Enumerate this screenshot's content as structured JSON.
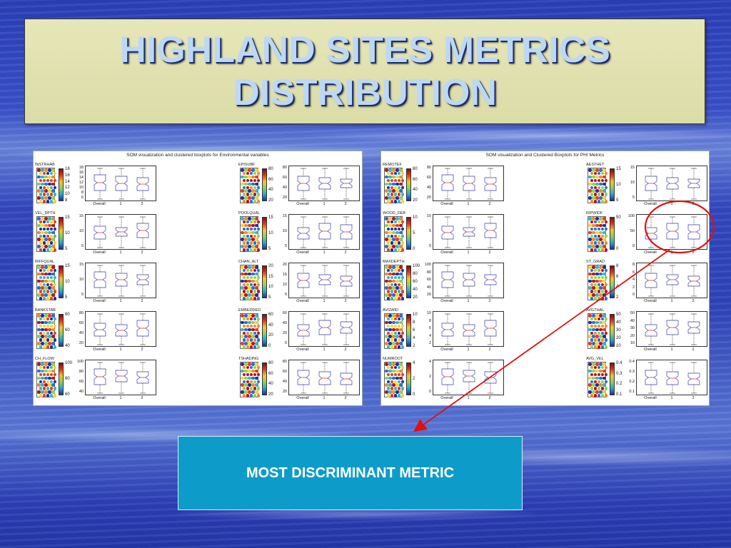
{
  "title": {
    "line1": "HIGHLAND SITES METRICS",
    "line2": "DISTRIBUTION"
  },
  "left_figure": {
    "title": "SOM visualization and clustered boxplots for Environmental variables",
    "x_labels": [
      "Overall",
      "1",
      "2"
    ],
    "panels": [
      {
        "label": "INSTRHAB",
        "cb_ticks": [
          "18",
          "16",
          "14",
          "12",
          "10",
          "8"
        ],
        "y_ticks": [
          "18",
          "16",
          "14",
          "12",
          "10",
          "8",
          "6"
        ]
      },
      {
        "label": "EPISUBF",
        "cb_ticks": [
          "80",
          "60",
          "40",
          "20"
        ],
        "y_ticks": [
          "80",
          "60",
          "40",
          "20"
        ]
      },
      {
        "label": "VEL_DPTH",
        "cb_ticks": [
          "15",
          "10",
          "5"
        ],
        "y_ticks": [
          "15",
          "10",
          "5"
        ]
      },
      {
        "label": "POOLQUAL",
        "cb_ticks": [
          "15",
          "10",
          "5"
        ],
        "y_ticks": [
          "15",
          "10",
          "5"
        ]
      },
      {
        "label": "RIFFQUAL",
        "cb_ticks": [
          "15",
          "10",
          "5"
        ],
        "y_ticks": [
          "15",
          "10",
          "5"
        ]
      },
      {
        "label": "CHAN_ALT",
        "cb_ticks": [
          "20",
          "15",
          "10",
          "5"
        ],
        "y_ticks": [
          "20",
          "15",
          "10",
          "5"
        ]
      },
      {
        "label": "BANKSTAB",
        "cb_ticks": [
          "80",
          "60",
          "40"
        ],
        "y_ticks": [
          "80",
          "60",
          "40",
          "20"
        ]
      },
      {
        "label": "EMBEDDED",
        "cb_ticks": [
          "60",
          "40",
          "20",
          "0"
        ],
        "y_ticks": [
          "60",
          "40",
          "20",
          "0"
        ]
      },
      {
        "label": "CH_FLOW",
        "cb_ticks": [
          "100",
          "80",
          "60"
        ],
        "y_ticks": [
          "100",
          "80",
          "60",
          "40"
        ]
      },
      {
        "label": "TSHADING",
        "cb_ticks": [
          "80",
          "60",
          "40",
          "20"
        ],
        "y_ticks": [
          "80",
          "60",
          "40",
          "20"
        ]
      }
    ]
  },
  "right_figure": {
    "title": "SOM visualization and Clustered Boxplots for PHI Metrics",
    "x_labels": [
      "Overall",
      "1",
      "2"
    ],
    "panels": [
      {
        "label": "REMOTEF",
        "cb_ticks": [
          "80",
          "60",
          "40",
          "20"
        ],
        "y_ticks": [
          "80",
          "60",
          "40",
          "20"
        ]
      },
      {
        "label": "AESTHET",
        "cb_ticks": [
          "15",
          "10",
          "5"
        ],
        "y_ticks": [
          "15",
          "10",
          "5"
        ]
      },
      {
        "label": "WOOD_DEB",
        "cb_ticks": [
          "10",
          "5",
          "0"
        ],
        "y_ticks": [
          "10",
          "5",
          "0"
        ]
      },
      {
        "label": "RIPWIDF",
        "cb_ticks": [
          "50",
          "0"
        ],
        "y_ticks": [
          "100",
          "50",
          "0"
        ]
      },
      {
        "label": "MAXDEPTH",
        "cb_ticks": [
          "100",
          "80",
          "60",
          "40",
          "20"
        ],
        "y_ticks": [
          "100",
          "80",
          "60",
          "40",
          "20"
        ]
      },
      {
        "label": "ST_GRAD",
        "cb_ticks": [
          "8",
          "6",
          "4",
          "2"
        ],
        "y_ticks": [
          "8",
          "6",
          "4",
          "2",
          "0"
        ]
      },
      {
        "label": "AVGWID",
        "cb_ticks": [
          "10",
          "8",
          "6",
          "4",
          "2"
        ],
        "y_ticks": [
          "10",
          "8",
          "6",
          "4",
          "2"
        ]
      },
      {
        "label": "AVGTHAL",
        "cb_ticks": [
          "50",
          "40",
          "30",
          "20",
          "10"
        ],
        "y_ticks": [
          "50",
          "40",
          "30",
          "20",
          "10"
        ]
      },
      {
        "label": "NUMROOT",
        "cb_ticks": [
          "4",
          "2",
          "0"
        ],
        "y_ticks": [
          "4",
          "2",
          "0"
        ]
      },
      {
        "label": "AVG_VEL",
        "cb_ticks": [
          "0.4",
          "0.3",
          "0.2",
          "0.1"
        ],
        "y_ticks": [
          "0.4",
          "0.3",
          "0.2",
          "0.1"
        ]
      }
    ]
  },
  "callout": {
    "text": "MOST DISCRIMINANT METRIC"
  },
  "colors": {
    "annotation_red": "#e01010",
    "callout_bg": "#0d9cc9",
    "title_bg": "#e0e0ae",
    "title_text": "#bcd8f2"
  }
}
